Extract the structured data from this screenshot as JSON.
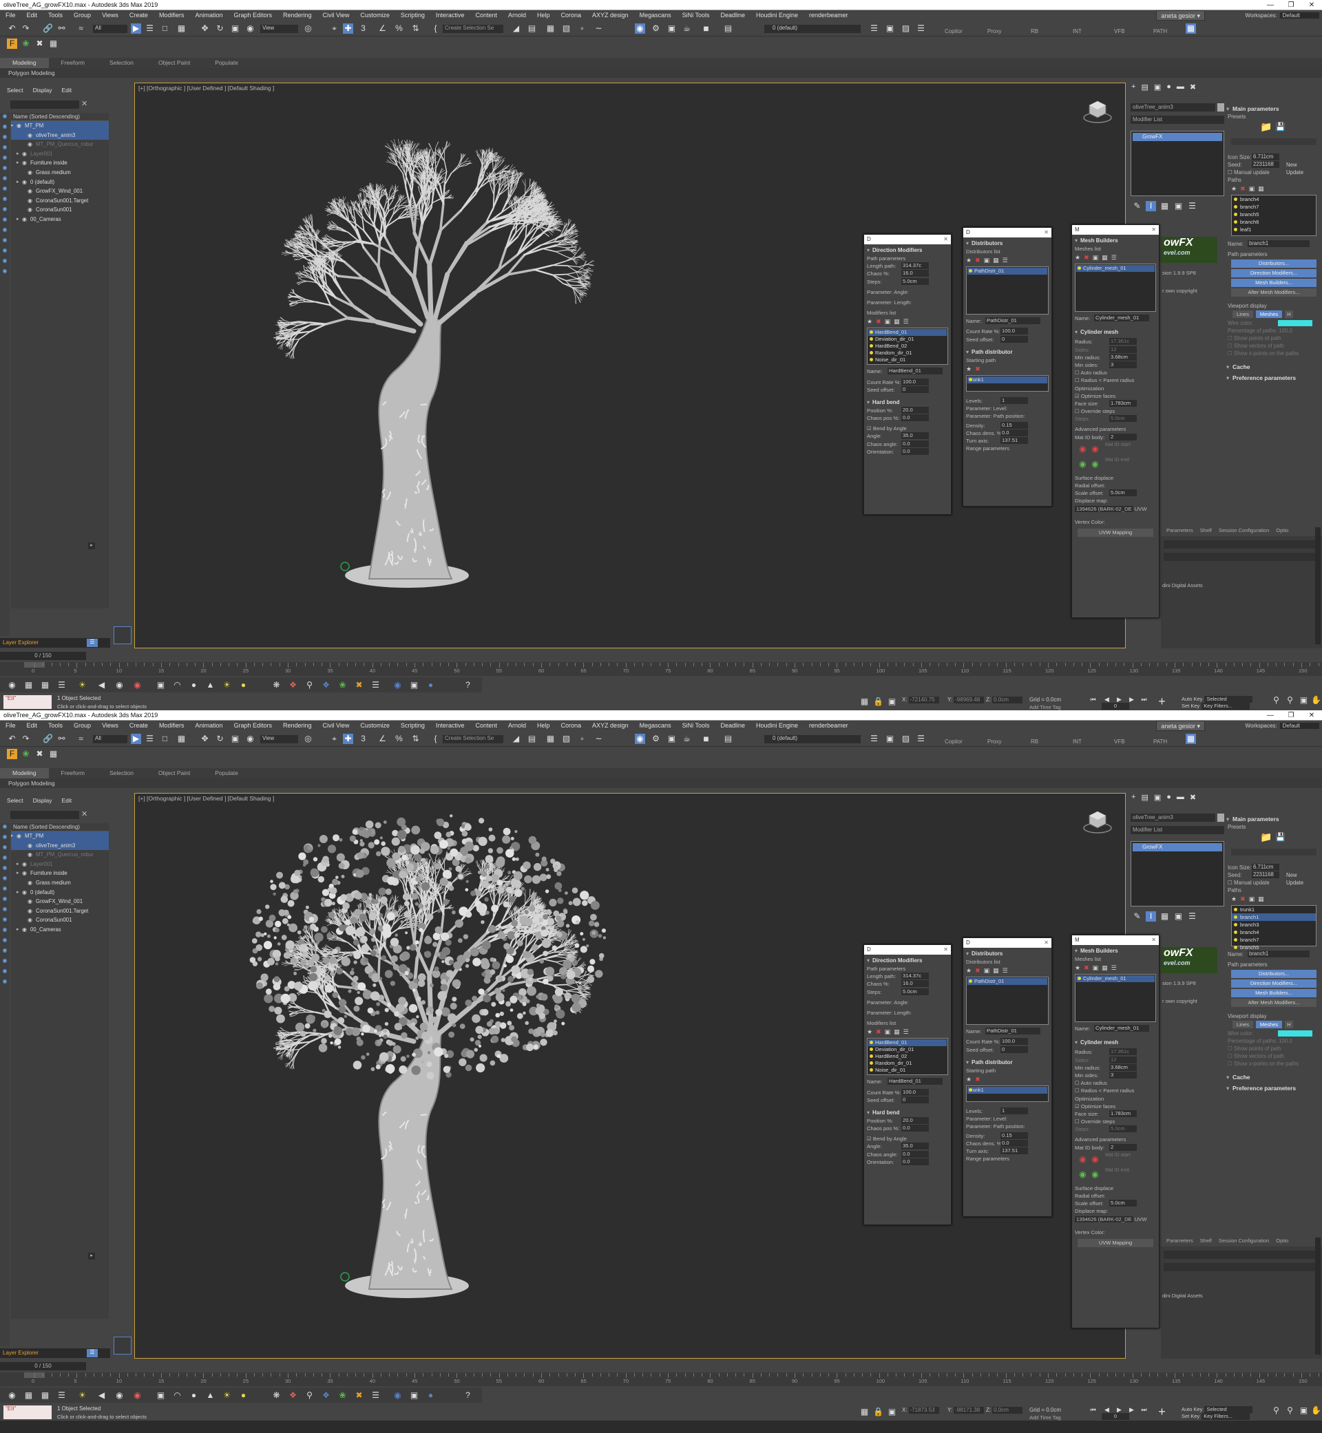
{
  "title": "oliveTree_AG_growFX10.max - Autodesk 3ds Max 2019",
  "menu": [
    "File",
    "Edit",
    "Tools",
    "Group",
    "Views",
    "Create",
    "Modifiers",
    "Animation",
    "Graph Editors",
    "Rendering",
    "Civil View",
    "Customize",
    "Scripting",
    "Interactive",
    "Content",
    "Arnold",
    "Help",
    "Corona",
    "AXYZ design",
    "Megascans",
    "SiNi Tools",
    "Deadline",
    "Houdini Engine",
    "renderbeamer"
  ],
  "user": "aneta gesior",
  "workspace_label": "Workspaces:",
  "workspace_value": "Default",
  "toolbar": {
    "filter_all": "All",
    "view_dropdown": "View",
    "selection_set": "Create Selection Se",
    "layer_default": "0 (default)",
    "plugins": [
      "Copitor",
      "Proxy",
      "RB",
      "INT",
      "VFB",
      "PATH"
    ]
  },
  "ribbon_tabs": [
    "Modeling",
    "Freeform",
    "Selection",
    "Object Paint",
    "Populate"
  ],
  "ribbon_sub": "Polygon Modeling",
  "scene_explorer": {
    "menu": [
      "Select",
      "Display",
      "Edit"
    ],
    "header": "Name (Sorted Descending)",
    "rows": [
      {
        "label": "MT_PM",
        "indent": 0,
        "sel": true
      },
      {
        "label": "oliveTree_anim3",
        "indent": 2,
        "sel": true
      },
      {
        "label": "MT_PM_Quercus_robur",
        "indent": 2,
        "dim": true
      },
      {
        "label": "Layer001",
        "indent": 1,
        "dim": true
      },
      {
        "label": "Furniture inside",
        "indent": 1
      },
      {
        "label": "Grass medium",
        "indent": 2
      },
      {
        "label": "0 (default)",
        "indent": 1
      },
      {
        "label": "GrowFX_Wind_001",
        "indent": 2
      },
      {
        "label": "CoronaSun001.Target",
        "indent": 2
      },
      {
        "label": "CoronaSun001",
        "indent": 2
      },
      {
        "label": "00_Cameras",
        "indent": 1
      }
    ],
    "layer_explorer": "Layer Explorer",
    "frame": "0 / 150"
  },
  "viewport_label": "[+] [Orthographic ] [User Defined ] [Default Shading ]",
  "command_panel": {
    "object_name": "oliveTree_anim3",
    "modifier_list": "Modifier List",
    "stack_item": "GrowFX",
    "main_parameters": "Main parameters",
    "presets": "Presets",
    "icon_size_label": "Icon Size:",
    "icon_size": "6.711cm",
    "seed_label": "Seed:",
    "seed": "2231168",
    "new_btn": "New",
    "manual_update": "Manual update",
    "update_btn": "Update",
    "paths_label": "Paths",
    "paths_top": [
      "branch4",
      "branch7",
      "branch5",
      "branch6",
      "leaf1"
    ],
    "paths_bottom": [
      "trunk1",
      "branch1",
      "branch3",
      "branch4",
      "branch7",
      "branch5"
    ],
    "name_label": "Name:",
    "name_value": "branch1",
    "path_parameters": "Path parameters",
    "btn_distributors": "Distributors...",
    "btn_direction": "Direction Modifiers...",
    "btn_mesh": "Mesh Builders...",
    "btn_after": "After Mesh Modifiers...",
    "viewport_display": "Viewport display",
    "vd_lines": "Lines",
    "vd_meshes": "Meshes",
    "vd_h": "H",
    "wire_color": "Wire color:",
    "pct_paths_label": "Percentage of paths:",
    "pct_paths_value": "100.0",
    "show_points": "Show points of path",
    "show_vectors": "Show vectors of path",
    "show_xpoints": "Show x-points on the paths",
    "cache": "Cache",
    "preference": "Preference parameters",
    "growfx_version": "sion 1.9.9 SP8",
    "growfx_copy": "r own copyright",
    "growfx_logo": "owFX",
    "growfx_site": "evel.com",
    "bottom_tabs": [
      "Parameters",
      "Shelf",
      "Session Configuration",
      "Optio"
    ],
    "assets": "dini Digital Assets"
  },
  "direction_win": {
    "title": "D",
    "head": "Direction Modifiers",
    "path_params": "Path parameters",
    "length_label": "Length path:",
    "length": "314.37c",
    "chaos_label": "Chaos %:",
    "chaos": "16.0",
    "steps_label": "Steps:",
    "steps": "5.0cm",
    "pangle": "Parameter: Angle:",
    "plength": "Parameter: Length:",
    "mods_label": "Modifiers list",
    "mods": [
      "HardBend_01",
      "Deviation_dir_01",
      "HardBend_02",
      "Random_dir_01",
      "Noise_dir_01"
    ],
    "name_label": "Name:",
    "name": "HardBend_01",
    "count_label": "Count Rate %:",
    "count": "100.0",
    "seed_label": "Seed offset:",
    "seed": "0",
    "hard_bend": "Hard bend",
    "position_label": "Position %:",
    "position": "20.0",
    "chaospos_label": "Chaos pos %:",
    "chaospos": "0.0",
    "bend_by_angle": "Bend by Angle",
    "angle_label": "Angle:",
    "angle": "35.0",
    "chaosangle_label": "Chaos angle:",
    "chaosangle": "0.0",
    "orient_label": "Orientation:",
    "orient": "0.0"
  },
  "distributors_win": {
    "title": "D",
    "head": "Distributors",
    "list_label": "Distributors list",
    "item": "PathDistr_01",
    "name_label": "Name:",
    "name": "PathDistr_01",
    "count_label": "Count Rate %:",
    "count": "100.0",
    "seed_label": "Seed offset:",
    "seed": "0",
    "pd_head": "Path distributor",
    "starting_path": "Starting path",
    "start_item": "trunk1",
    "levels_label": "Levels:",
    "levels": "1",
    "plevel": "Parameter: Level:",
    "ppos": "Parameter: Path position:",
    "density_label": "Density:",
    "density": "0.15",
    "chaosdens_label": "Chaos dens. %:",
    "chaosdens": "0.0",
    "turn_label": "Turn axis:",
    "turn": "137.51",
    "range": "Range parameters"
  },
  "mesh_win": {
    "title": "M",
    "head": "Mesh Builders",
    "list_label": "Meshes list",
    "item": "Cylinder_mesh_01",
    "name_label": "Name:",
    "name": "Cylinder_mesh_01",
    "cyl_head": "Cylinder mesh",
    "radius_label": "Radius:",
    "radius": "17.361c",
    "sides_label": "Sides:",
    "sides": "12",
    "minrad_label": "Min radius:",
    "minrad": "3.68cm",
    "minsides_label": "Min sides:",
    "minsides": "3",
    "auto_radius": "Auto radius",
    "radius_parent": "Radius < Parent radius",
    "optimization": "Optimization",
    "optimize_faces": "Optimize faces",
    "face_label": "Face size:",
    "face": "1.783cm",
    "override_steps": "Override steps",
    "steps_label": "Steps:",
    "steps": "5.0cm",
    "adv": "Advanced parameters",
    "matid_label": "Mat ID body:",
    "matid": "2",
    "matid_start": "Mat ID start:",
    "matid_end": "Mat ID end:",
    "surface_disp": "Surface displace",
    "radial_label": "Radial offset:",
    "scale_label": "Scale offset:",
    "scale": "5.0cm",
    "dispmap_label": "Displace map:",
    "dispmap": "1394626 (BARK-02_DE",
    "uvw": "UVW",
    "vertex_color": "Vertex Color:",
    "uvw_mapping": "UVW Mapping"
  },
  "timeline_ticks": [
    "0",
    "5",
    "10",
    "15",
    "20",
    "25",
    "30",
    "35",
    "40",
    "45",
    "50",
    "55",
    "60",
    "65",
    "70",
    "75",
    "80",
    "85",
    "90",
    "95",
    "100",
    "105",
    "110",
    "115",
    "120",
    "125",
    "130",
    "135",
    "140",
    "145",
    "150"
  ],
  "status": {
    "maxscript": "\"EII\"",
    "selected": "1 Object Selected",
    "hint": "Click or click-and-drag to select objects",
    "x_label": "X:",
    "y_label": "Y:",
    "z_label": "Z:",
    "x_top": "-72140.75",
    "y_top": "-98969.48",
    "z_top": "0.0cm",
    "x_bot": "-71873.53",
    "y_bot": "-98171.38",
    "z_bot": "0.0cm",
    "grid": "Grid = 0.0cm",
    "add_time_tag": "Add Time Tag",
    "auto_key": "Auto Key",
    "set_key": "Set Key",
    "selected_dd": "Selected",
    "key_filters": "Key Filters...",
    "frame_val": "0"
  }
}
